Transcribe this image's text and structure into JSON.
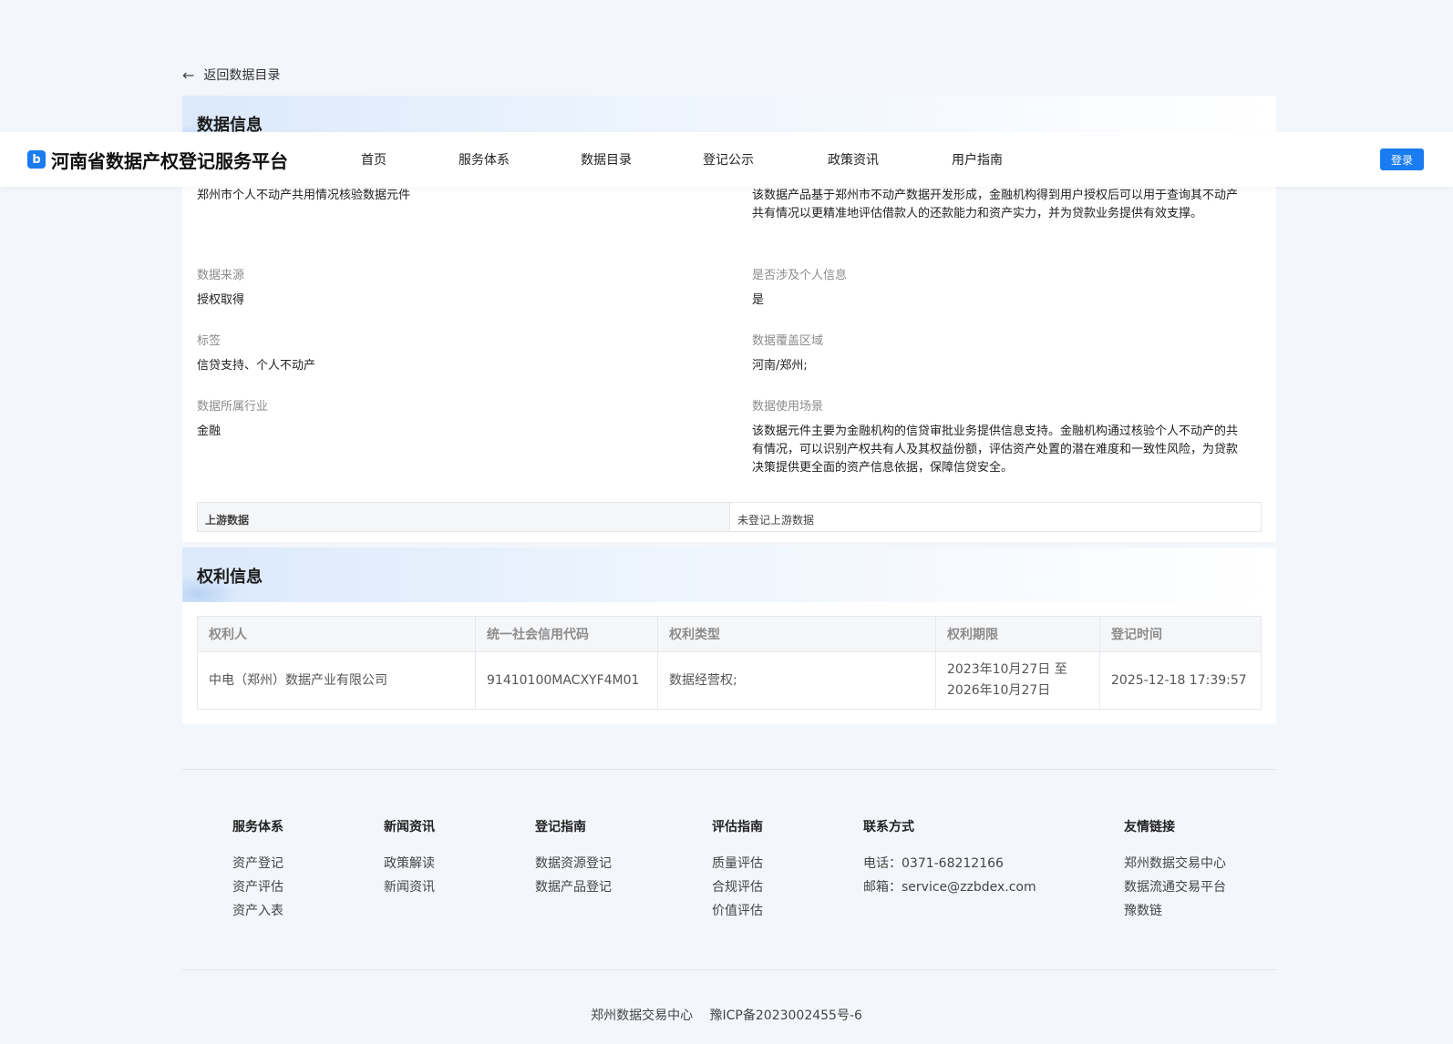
{
  "back_link": "返回数据目录",
  "header": {
    "logo_glyph": "b",
    "title": "河南省数据产权登记服务平台",
    "nav": [
      "首页",
      "服务体系",
      "数据目录",
      "登记公示",
      "政策资讯",
      "用户指南"
    ],
    "login": "登录"
  },
  "data_info": {
    "title": "数据信息",
    "name_value": "郑州市个人不动产共用情况核验数据元件",
    "description_value": "该数据产品基于郑州市不动产数据开发形成，金融机构得到用户授权后可以用于查询其不动产共有情况以更精准地评估借款人的还款能力和资产实力，并为贷款业务提供有效支撑。",
    "source_label": "数据来源",
    "source_value": "授权取得",
    "personal_label": "是否涉及个人信息",
    "personal_value": "是",
    "tags_label": "标签",
    "tags_value": "信贷支持、个人不动产",
    "region_label": "数据覆盖区域",
    "region_value": "河南/郑州;",
    "industry_label": "数据所属行业",
    "industry_value": "金融",
    "scenario_label": "数据使用场景",
    "scenario_value": "该数据元件主要为金融机构的信贷审批业务提供信息支持。金融机构通过核验个人不动产的共有情况，可以识别产权共有人及其权益份额，评估资产处置的潜在难度和一致性风险，为贷款决策提供更全面的资产信息依据，保障信贷安全。",
    "upstream_label": "上游数据",
    "upstream_value": "未登记上游数据"
  },
  "rights_info": {
    "title": "权利信息",
    "columns": [
      "权利人",
      "统一社会信用代码",
      "权利类型",
      "权利期限",
      "登记时间"
    ],
    "row": {
      "holder": "中电（郑州）数据产业有限公司",
      "credit_code": "91410100MACXYF4M01",
      "type": "数据经营权;",
      "term_start": "2023年10月27日 至",
      "term_end": "2026年10月27日",
      "registered": "2025-12-18 17:39:57"
    }
  },
  "footer": {
    "cols": [
      {
        "title": "服务体系",
        "items": [
          "资产登记",
          "资产评估",
          "资产入表"
        ]
      },
      {
        "title": "新闻资讯",
        "items": [
          "政策解读",
          "新闻资讯"
        ]
      },
      {
        "title": "登记指南",
        "items": [
          "数据资源登记",
          "数据产品登记"
        ]
      },
      {
        "title": "评估指南",
        "items": [
          "质量评估",
          "合规评估",
          "价值评估"
        ]
      },
      {
        "title": "联系方式",
        "items": [
          "电话：0371-68212166",
          "邮箱：service@zzbdex.com"
        ]
      },
      {
        "title": "友情链接",
        "items": [
          "郑州数据交易中心",
          "数据流通交易平台",
          "豫数链"
        ]
      }
    ],
    "org": "郑州数据交易中心",
    "icp": "豫ICP备2023002455号-6"
  },
  "colors": {
    "primary": "#1a7cf0",
    "page_bg": "#f3f6fb"
  }
}
